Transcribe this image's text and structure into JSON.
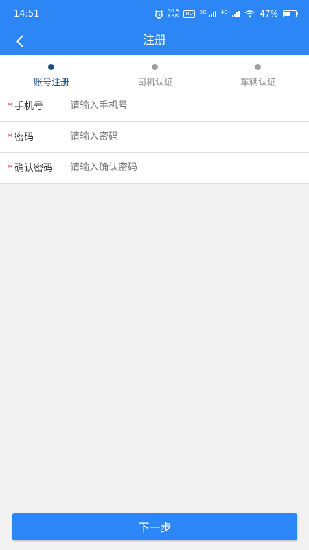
{
  "status_bar": {
    "time": "14:51",
    "net_speed_value": "50.8",
    "net_speed_unit": "KB/s",
    "hd_badge": "HD",
    "sim1_label": "5G",
    "sim2_label": "4G⁺",
    "battery": "47%",
    "battery_level": 0.47
  },
  "nav": {
    "title": "注册",
    "back_icon": "chevron-left-icon"
  },
  "stepper": {
    "steps": [
      {
        "label": "账号注册",
        "active": true
      },
      {
        "label": "司机认证",
        "active": false
      },
      {
        "label": "车辆认证",
        "active": false
      }
    ]
  },
  "form": {
    "required_mark": "*",
    "fields": [
      {
        "label": "手机号",
        "placeholder": "请输入手机号",
        "value": ""
      },
      {
        "label": "密码",
        "placeholder": "请输入密码",
        "value": ""
      },
      {
        "label": "确认密码",
        "placeholder": "请输入确认密码",
        "value": ""
      }
    ]
  },
  "footer": {
    "next_label": "下一步"
  },
  "colors": {
    "primary": "#2c86f5",
    "step_active": "#1d4f7e",
    "step_inactive": "#9e9e9e",
    "required": "#e53935",
    "background": "#f2f2f2"
  }
}
